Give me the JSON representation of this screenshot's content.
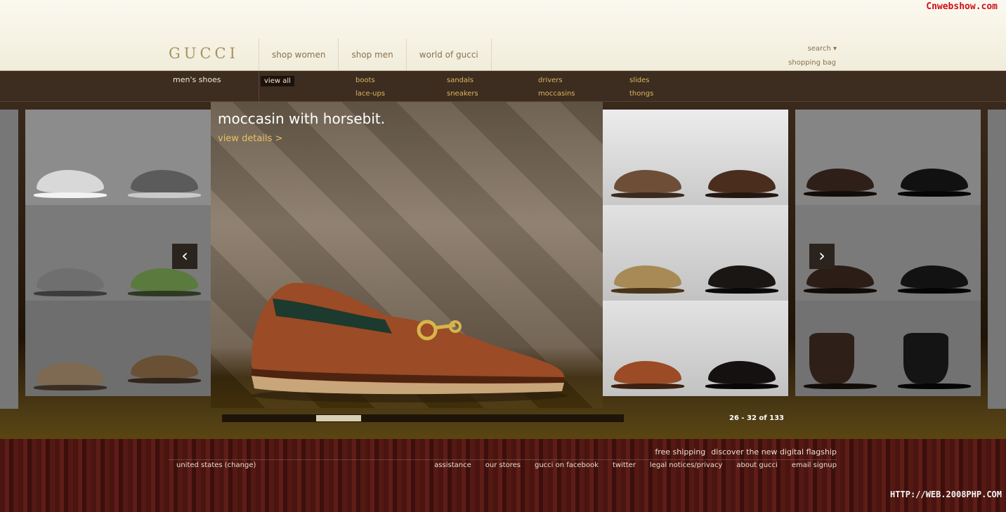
{
  "watermarks": {
    "top": "Cnwebshow.com",
    "bottom": "HTTP://WEB.2008PHP.COM"
  },
  "header": {
    "logo": "GUCCI",
    "nav": [
      "shop women",
      "shop men",
      "world of gucci"
    ],
    "search": "search",
    "bag": "shopping bag"
  },
  "subnav": {
    "title": "men's shoes",
    "view_all": "view all",
    "categories": [
      "boots",
      "sandals",
      "drivers",
      "slides",
      "lace-ups",
      "sneakers",
      "moccasins",
      "thongs"
    ]
  },
  "featured": {
    "title": "moccasin with horsebit.",
    "link": "view details >"
  },
  "pagination": {
    "label": "26 - 32 of 133",
    "thumb_start": 0.234,
    "thumb_fraction": 0.112
  },
  "footer": {
    "promo": [
      "free shipping",
      "discover the new digital flagship"
    ],
    "region": "united states (change)",
    "links": [
      "assistance",
      "our stores",
      "gucci on facebook",
      "twitter",
      "legal notices/privacy",
      "about gucci",
      "email signup"
    ]
  },
  "colors": {
    "shoe_grey": "#6f6f6f",
    "shoe_brown": "#7a5136",
    "shoe_black": "#1a1614",
    "shoe_green": "#5b7a3e",
    "shoe_tan": "#a78a55",
    "hero": "#9b4b25"
  }
}
